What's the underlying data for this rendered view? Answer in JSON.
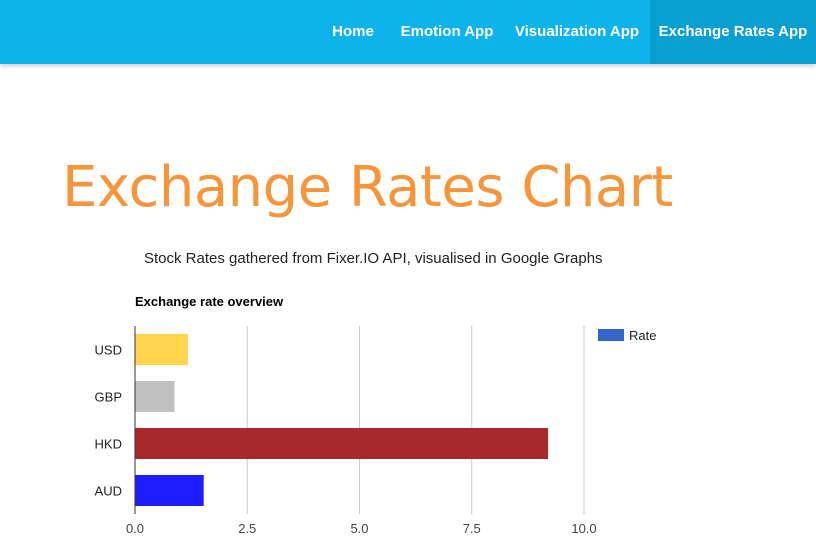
{
  "nav": {
    "items": [
      {
        "label": "Home"
      },
      {
        "label": "Emotion App"
      },
      {
        "label": "Visualization App"
      },
      {
        "label": "Exchange Rates App",
        "active": true
      }
    ],
    "bg_color": "#0fb3eb",
    "active_color": "#0a9fd2"
  },
  "page": {
    "title": "Exchange Rates Chart",
    "title_color": "#f7953a",
    "subtitle": "Stock Rates gathered from Fixer.IO API, visualised in Google Graphs"
  },
  "chart_data": {
    "type": "bar",
    "orientation": "horizontal",
    "title": "Exchange rate overview",
    "categories": [
      "USD",
      "GBP",
      "HKD",
      "AUD"
    ],
    "series": [
      {
        "name": "Rate",
        "values": [
          1.18,
          0.88,
          9.2,
          1.53
        ]
      }
    ],
    "bar_colors": [
      "#ffd54f",
      "#c0c0c0",
      "#a8282c",
      "#1d1dff"
    ],
    "legend_color": "#3366cc",
    "xlim": [
      0,
      10
    ],
    "xticks": [
      "0.0",
      "2.5",
      "5.0",
      "7.5",
      "10.0"
    ],
    "grid": true,
    "legend_position": "right"
  }
}
